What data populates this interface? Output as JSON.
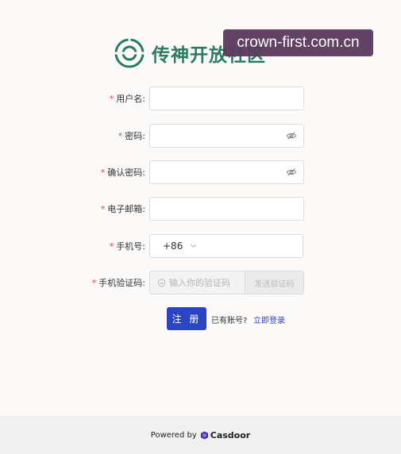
{
  "brand": {
    "name": "传神开放社区"
  },
  "watermark": {
    "text": "crown-first.com.cn"
  },
  "form": {
    "username_label": "用户名:",
    "password_label": "密码:",
    "confirm_password_label": "确认密码:",
    "email_label": "电子邮箱:",
    "phone_label": "手机号:",
    "phone_code": "+86",
    "phone_code_label": "手机验证码:",
    "code_placeholder": "输入你的验证码",
    "send_code_label": "发送验证码",
    "required_mark": "*"
  },
  "actions": {
    "register_label": "注 册",
    "have_account_text": "已有账号?",
    "login_link": "立即登录"
  },
  "footer": {
    "powered_by": "Powered by",
    "vendor": "Casdoor"
  },
  "colors": {
    "accent": "#2b45c2",
    "brand": "#2b7a63",
    "required": "#e0444a"
  },
  "icons": [
    "logo-icon",
    "eye-off-icon",
    "chevron-down-icon",
    "shield-icon",
    "casdoor-logo-icon"
  ]
}
